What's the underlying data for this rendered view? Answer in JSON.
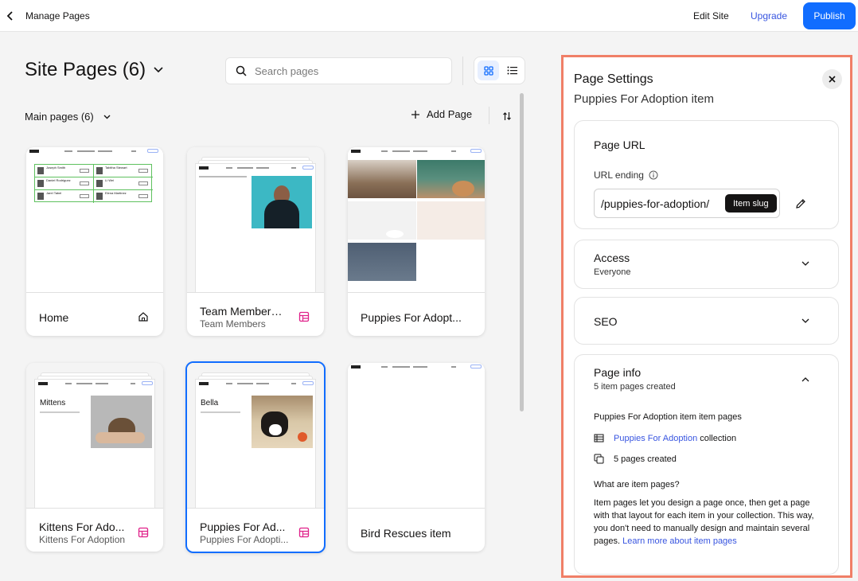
{
  "topbar": {
    "title": "Manage Pages",
    "edit_site": "Edit Site",
    "upgrade": "Upgrade",
    "publish": "Publish"
  },
  "header": {
    "site_title": "Site Pages (6)",
    "search_placeholder": "Search pages",
    "main_pages": "Main pages (6)",
    "add_page": "Add Page"
  },
  "pages": [
    {
      "label": "Home",
      "sub": "",
      "icon": "home-icon",
      "selected": false
    },
    {
      "label": "Team Members ...",
      "sub": "Team Members",
      "icon": "dynamic-page-icon",
      "selected": false
    },
    {
      "label": "Puppies For Adopt...",
      "sub": "",
      "icon": "",
      "selected": false
    },
    {
      "label": "Kittens For Ado...",
      "sub": "Kittens For Adoption",
      "icon": "dynamic-page-icon",
      "selected": false
    },
    {
      "label": "Puppies For Ad...",
      "sub": "Puppies For Adopti...",
      "icon": "dynamic-page-icon",
      "selected": true
    },
    {
      "label": "Bird Rescues item",
      "sub": "",
      "icon": "",
      "selected": false
    }
  ],
  "thumbs": {
    "home": {
      "members": [
        "Joseph Smith",
        "Tabitha Stewart",
        "Daniel Rodriguez",
        "Li Wei",
        "Jarel Tabel",
        "Elena Martinez"
      ]
    },
    "kittens_title": "Mittens",
    "puppies_title": "Bella"
  },
  "panel": {
    "title": "Page Settings",
    "subtitle": "Puppies For Adoption item",
    "url": {
      "title": "Page URL",
      "label": "URL ending",
      "value": "/puppies-for-adoption/",
      "slug": "Item slug"
    },
    "access": {
      "title": "Access",
      "value": "Everyone"
    },
    "seo": {
      "title": "SEO"
    },
    "info": {
      "title": "Page info",
      "value": "5 item pages created",
      "heading": "Puppies For Adoption item item pages",
      "collection_link": "Puppies For Adoption",
      "collection_suffix": " collection",
      "pages_created": "5 pages created",
      "what_heading": "What are item pages?",
      "what_body": "Item pages let you design a page once, then get a page with that layout for each item in your collection. This way, you don't need to manually design and maintain several pages. ",
      "learn_more": "Learn more about item pages"
    }
  },
  "colors": {
    "accent": "#116dff",
    "link": "#3855e0",
    "panel_border": "#f07f67",
    "dynamic_icon": "#e0218a"
  }
}
